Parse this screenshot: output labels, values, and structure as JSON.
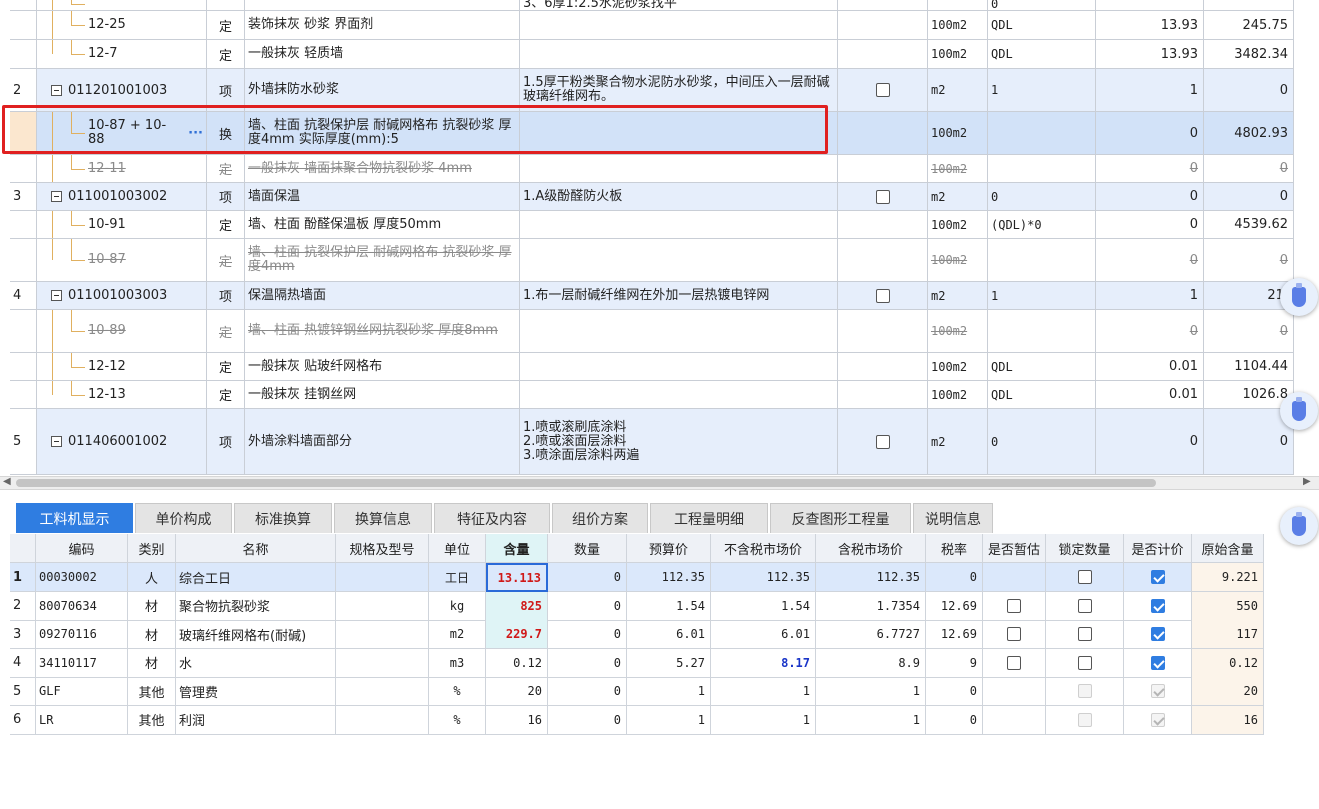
{
  "upper_rows": [
    {
      "kind": "sub",
      "num": "",
      "code": "",
      "type": "",
      "name": "",
      "feature": "3、6厚1:2.5水泥砂浆找平",
      "unit": "",
      "expr": "0",
      "qty": "",
      "price": ""
    },
    {
      "kind": "sub",
      "num": "",
      "code": "12-25",
      "type": "定",
      "name": "装饰抹灰 砂浆 界面剂",
      "feature": "",
      "unit": "100m2",
      "expr": "QDL",
      "qty": "13.93",
      "price": "245.75"
    },
    {
      "kind": "sub",
      "num": "",
      "code": "12-7",
      "type": "定",
      "name": "一般抹灰 轻质墙",
      "feature": "",
      "unit": "100m2",
      "expr": "QDL",
      "qty": "13.93",
      "price": "3482.34"
    },
    {
      "kind": "qd",
      "num": "2",
      "code": "011201001003",
      "type": "项",
      "name": "外墙抹防水砂浆",
      "feature": "1.5厚干粉类聚合物水泥防水砂浆，中间压入一层耐碱玻璃纤维网布。",
      "unit": "m2",
      "expr": "1",
      "qty": "1",
      "price": "0"
    },
    {
      "kind": "sel",
      "num": "",
      "code": "10-87 + 10-88",
      "type": "换",
      "name": "墙、柱面 抗裂保护层 耐碱网格布 抗裂砂浆 厚度4mm  实际厚度(mm):5",
      "feature": "",
      "unit": "100m2",
      "expr": "",
      "qty": "0",
      "price": "4802.93",
      "more": "···"
    },
    {
      "kind": "strike",
      "num": "",
      "code": "12-11",
      "type": "定",
      "name": "一般抹灰 墙面抹聚合物抗裂砂浆 4mm",
      "feature": "",
      "unit": "100m2",
      "expr": "",
      "qty": "0",
      "price": "0"
    },
    {
      "kind": "qd",
      "num": "3",
      "code": "011001003002",
      "type": "项",
      "name": "墙面保温",
      "feature": "1.A级酚醛防火板",
      "unit": "m2",
      "expr": "0",
      "qty": "0",
      "price": "0"
    },
    {
      "kind": "sub",
      "num": "",
      "code": "10-91",
      "type": "定",
      "name": "墙、柱面 酚醛保温板 厚度50mm",
      "feature": "",
      "unit": "100m2",
      "expr": "(QDL)*0",
      "qty": "0",
      "price": "4539.62"
    },
    {
      "kind": "strike",
      "num": "",
      "code": "10-87",
      "type": "定",
      "name": "墙、柱面 抗裂保护层 耐碱网格布 抗裂砂浆 厚度4mm",
      "feature": "",
      "unit": "100m2",
      "expr": "",
      "qty": "0",
      "price": "0"
    },
    {
      "kind": "qd",
      "num": "4",
      "code": "011001003003",
      "type": "项",
      "name": "保温隔热墙面",
      "feature": " 1.布一层耐碱纤维网在外加一层热镀电锌网",
      "unit": "m2",
      "expr": "1",
      "qty": "1",
      "price": "21."
    },
    {
      "kind": "strike",
      "num": "",
      "code": "10-89",
      "type": "定",
      "name": "墙、柱面 热镀锌钢丝网抗裂砂浆 厚度8mm",
      "feature": "",
      "unit": "100m2",
      "expr": "",
      "qty": "0",
      "price": "0"
    },
    {
      "kind": "sub",
      "num": "",
      "code": "12-12",
      "type": "定",
      "name": "一般抹灰 贴玻纤网格布",
      "feature": "",
      "unit": "100m2",
      "expr": "QDL",
      "qty": "0.01",
      "price": "1104.44"
    },
    {
      "kind": "sub",
      "num": "",
      "code": "12-13",
      "type": "定",
      "name": "一般抹灰 挂钢丝网",
      "feature": "",
      "unit": "100m2",
      "expr": "QDL",
      "qty": "0.01",
      "price": "1026.8"
    },
    {
      "kind": "qd",
      "num": "5",
      "code": "011406001002",
      "type": "项",
      "name": "外墙涂料墙面部分",
      "feature": "1.喷或滚刷底涂料\n2.喷或滚面层涂料\n3.喷涂面层涂料两遍",
      "unit": "m2",
      "expr": "0",
      "qty": "0",
      "price": "0"
    }
  ],
  "tabs": [
    "工料机显示",
    "单价构成",
    "标准换算",
    "换算信息",
    "特征及内容",
    "组价方案",
    "工程量明细",
    "反查图形工程量",
    "说明信息"
  ],
  "lower_headers": [
    "编码",
    "类别",
    "名称",
    "规格及型号",
    "单位",
    "含量",
    "数量",
    "预算价",
    "不含税市场价",
    "含税市场价",
    "税率",
    "是否暂估",
    "锁定数量",
    "是否计价",
    "原始含量"
  ],
  "lower_rows": [
    {
      "num": "1",
      "code": "00030002",
      "cat": "人",
      "name": "综合工日",
      "spec": "",
      "unit": "工日",
      "content": "13.113",
      "qty": "0",
      "budget": "112.35",
      "mkt_ex": "112.35",
      "mkt_in": "112.35",
      "tax": "0",
      "est": "none",
      "lock": "off",
      "price_on": "on",
      "orig": "9.221"
    },
    {
      "num": "2",
      "code": "80070634",
      "cat": "材",
      "name": "聚合物抗裂砂浆",
      "spec": "",
      "unit": "kg",
      "content": "825",
      "qty": "0",
      "budget": "1.54",
      "mkt_ex": "1.54",
      "mkt_in": "1.7354",
      "tax": "12.69",
      "est": "off",
      "lock": "off",
      "price_on": "on",
      "orig": "550"
    },
    {
      "num": "3",
      "code": "09270116",
      "cat": "材",
      "name": "玻璃纤维网格布(耐碱)",
      "spec": "",
      "unit": "m2",
      "content": "229.7",
      "qty": "0",
      "budget": "6.01",
      "mkt_ex": "6.01",
      "mkt_in": "6.7727",
      "tax": "12.69",
      "est": "off",
      "lock": "off",
      "price_on": "on",
      "orig": "117"
    },
    {
      "num": "4",
      "code": "34110117",
      "cat": "材",
      "name": "水",
      "spec": "",
      "unit": "m3",
      "content": "0.12",
      "qty": "0",
      "budget": "5.27",
      "mkt_ex": "8.17",
      "mkt_in": "8.9",
      "tax": "9",
      "est": "off",
      "lock": "off",
      "price_on": "on",
      "orig": "0.12"
    },
    {
      "num": "5",
      "code": "GLF",
      "cat": "其他",
      "name": "管理费",
      "spec": "",
      "unit": "%",
      "content": "20",
      "qty": "0",
      "budget": "1",
      "mkt_ex": "1",
      "mkt_in": "1",
      "tax": "0",
      "est": "none",
      "lock": "dis",
      "price_on": "dison",
      "orig": "20"
    },
    {
      "num": "6",
      "code": "LR",
      "cat": "其他",
      "name": "利润",
      "spec": "",
      "unit": "%",
      "content": "16",
      "qty": "0",
      "budget": "1",
      "mkt_ex": "1",
      "mkt_in": "1",
      "tax": "0",
      "est": "none",
      "lock": "dis",
      "price_on": "dison",
      "orig": "16"
    }
  ],
  "scroll": {
    "left_arrow": "◀",
    "right_arrow": "▶"
  },
  "float_buttons": [
    "bottle-icon",
    "bottle-icon",
    "bottle-icon"
  ]
}
